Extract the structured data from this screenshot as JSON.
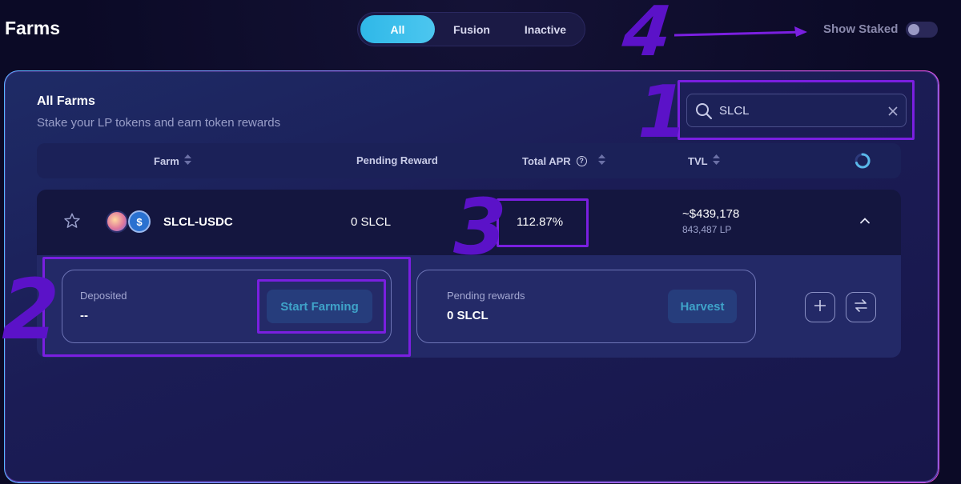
{
  "header": {
    "title": "Farms",
    "tabs": [
      "All",
      "Fusion",
      "Inactive"
    ],
    "show_staked_label": "Show Staked"
  },
  "annotations": [
    "4",
    "1",
    "3",
    "2"
  ],
  "panel": {
    "title": "All Farms",
    "subtitle": "Stake your LP tokens and earn token rewards",
    "search": {
      "value": "SLCL"
    },
    "columns": [
      "Farm",
      "Pending Reward",
      "Total APR",
      "TVL"
    ]
  },
  "farm": {
    "name": "SLCL-USDC",
    "pending_reward": "0 SLCL",
    "total_apr": "112.87%",
    "tvl": "~$439,178",
    "tvl_lp": "843,487 LP",
    "token_b_symbol": "$"
  },
  "details": {
    "deposited_label": "Deposited",
    "deposited_value": "--",
    "start_farming_label": "Start Farming",
    "pending_rewards_label": "Pending rewards",
    "pending_rewards_value": "0 SLCL",
    "harvest_label": "Harvest"
  },
  "colors": {
    "accent": "#2fb8e8",
    "annotation": "#7a1fe0",
    "background": "#0b0a26"
  },
  "icons": [
    "search-icon",
    "clear-icon",
    "sort-icon",
    "help-icon",
    "refresh-icon",
    "star-icon",
    "chevron-up-icon",
    "plus-icon",
    "swap-icon"
  ]
}
